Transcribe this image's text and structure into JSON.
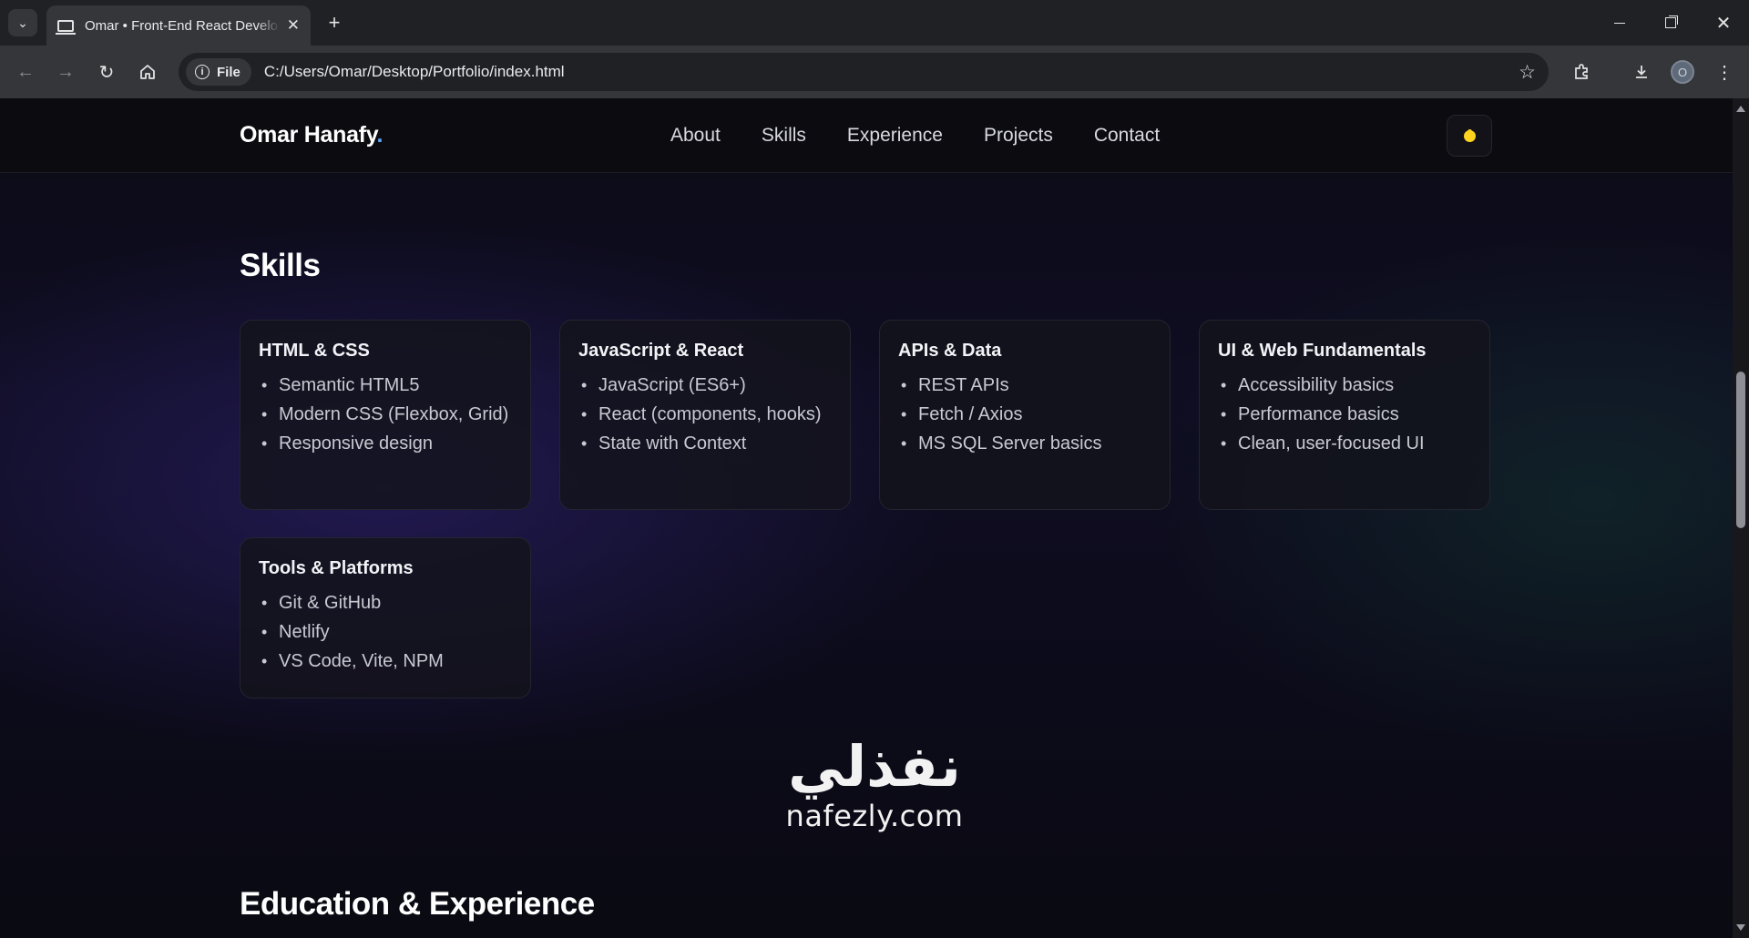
{
  "browser": {
    "tab_title": "Omar • Front-End React Developer",
    "tab_close": "✕",
    "new_tab": "+",
    "chip_label": "File",
    "url": "C:/Users/Omar/Desktop/Portfolio/index.html",
    "profile_initial": "O",
    "icons": [
      "tab-search-icon",
      "page-icon",
      "close-icon",
      "back-icon",
      "forward-icon",
      "reload-icon",
      "home-icon",
      "info-icon",
      "star-icon",
      "extensions-icon",
      "download-icon",
      "minimize-icon",
      "maximize-icon",
      "window-close-icon"
    ]
  },
  "site": {
    "brand": "Omar Hanafy",
    "brand_dot": ".",
    "nav": [
      "About",
      "Skills",
      "Experience",
      "Projects",
      "Contact"
    ],
    "theme_icon": "sun-icon",
    "accent_color": "#5fa8ff",
    "sun_color": "#ffd21f"
  },
  "skills": {
    "title": "Skills",
    "cards": [
      {
        "title": "HTML & CSS",
        "items": [
          "Semantic HTML5",
          "Modern CSS (Flexbox, Grid)",
          "Responsive design"
        ]
      },
      {
        "title": "JavaScript & React",
        "items": [
          "JavaScript (ES6+)",
          "React (components, hooks)",
          "State with Context"
        ]
      },
      {
        "title": "APIs & Data",
        "items": [
          "REST APIs",
          "Fetch / Axios",
          "MS SQL Server basics"
        ]
      },
      {
        "title": "UI & Web Fundamentals",
        "items": [
          "Accessibility basics",
          "Performance basics",
          "Clean, user-focused UI"
        ]
      },
      {
        "title": "Tools & Platforms",
        "items": [
          "Git & GitHub",
          "Netlify",
          "VS Code, Vite, NPM"
        ]
      }
    ]
  },
  "education": {
    "title": "Education & Experience"
  },
  "watermark": {
    "arabic": "نفذلي",
    "latin": "nafezly.com"
  }
}
